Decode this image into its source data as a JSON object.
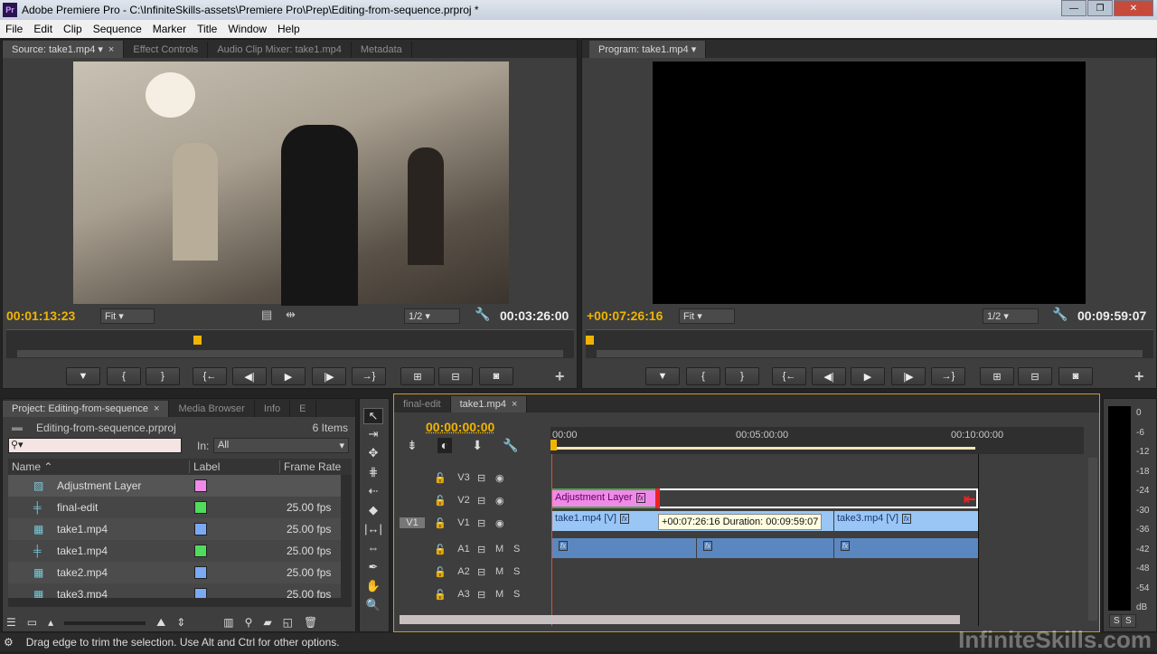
{
  "window": {
    "title": "Adobe Premiere Pro - C:\\InfiniteSkills-assets\\Premiere Pro\\Prep\\Editing-from-sequence.prproj *",
    "app_icon": "Pr"
  },
  "menu": [
    "File",
    "Edit",
    "Clip",
    "Sequence",
    "Marker",
    "Title",
    "Window",
    "Help"
  ],
  "source": {
    "tabs": [
      "Source: take1.mp4",
      "Effect Controls",
      "Audio Clip Mixer: take1.mp4",
      "Metadata"
    ],
    "timecode": "00:01:13:23",
    "zoom": "Fit",
    "resolution": "1/2",
    "duration": "00:03:26:00",
    "playhead_fraction": 0.33
  },
  "program": {
    "tab": "Program: take1.mp4",
    "timecode": "+00:07:26:16",
    "zoom": "Fit",
    "resolution": "1/2",
    "duration": "00:09:59:07",
    "playhead_fraction": 0.0
  },
  "transport": {
    "source": [
      "▼",
      "{",
      "}",
      "{←",
      "◀|",
      "▶",
      "|▶",
      "→}",
      "⊞",
      "⊟",
      "◙"
    ],
    "program": [
      "▼",
      "{",
      "}",
      "{←",
      "◀|",
      "▶",
      "|▶",
      "→}",
      "⊞",
      "⊟",
      "◙"
    ],
    "add": "+"
  },
  "project": {
    "tabs": [
      "Project: Editing-from-sequence",
      "Media Browser",
      "Info",
      "E"
    ],
    "file": "Editing-from-sequence.prproj",
    "count": "6 Items",
    "search_placeholder": "",
    "in_label": "In:",
    "in_value": "All",
    "columns": [
      "Name",
      "Label",
      "Frame Rate"
    ],
    "items": [
      {
        "name": "Adjustment Layer",
        "label_color": "#f08ae8",
        "fps": "",
        "icon": "adjustment-layer-icon"
      },
      {
        "name": "final-edit",
        "label_color": "#4fdc5c",
        "fps": "25.00 fps",
        "icon": "sequence-icon"
      },
      {
        "name": "take1.mp4",
        "label_color": "#7aaaf5",
        "fps": "25.00 fps",
        "icon": "clip-icon"
      },
      {
        "name": "take1.mp4",
        "label_color": "#4fdc5c",
        "fps": "25.00 fps",
        "icon": "sequence-icon"
      },
      {
        "name": "take2.mp4",
        "label_color": "#7aaaf5",
        "fps": "25.00 fps",
        "icon": "clip-icon"
      },
      {
        "name": "take3.mp4",
        "label_color": "#7aaaf5",
        "fps": "25.00 fps",
        "icon": "clip-icon"
      }
    ]
  },
  "tools": [
    "selection",
    "track-select",
    "ripple-edit",
    "rolling-edit",
    "rate-stretch",
    "razor",
    "slip",
    "slide",
    "pen",
    "hand",
    "zoom"
  ],
  "timeline": {
    "tabs": [
      "final-edit",
      "take1.mp4"
    ],
    "timecode": "00:00:00:00",
    "ruler": [
      "00:00",
      "00:05:00:00",
      "00:10:00:00"
    ],
    "video_tracks": [
      {
        "name": "V3"
      },
      {
        "name": "V2"
      },
      {
        "name": "V1",
        "source": "V1"
      }
    ],
    "audio_tracks": [
      {
        "name": "A1",
        "m": "M",
        "s": "S"
      },
      {
        "name": "A2",
        "m": "M",
        "s": "S"
      },
      {
        "name": "A3",
        "m": "M",
        "s": "S"
      }
    ],
    "clips": {
      "adjustment": "Adjustment Layer",
      "v1a": "take1.mp4 [V]",
      "v1b": "take3.mp4 [V]",
      "fx": "fx"
    },
    "tooltip": "+00:07:26:16 Duration: 00:09:59:07"
  },
  "meter": {
    "scale": [
      "0",
      "-6",
      "-12",
      "-18",
      "-24",
      "-30",
      "-36",
      "-42",
      "-48",
      "-54",
      "dB"
    ],
    "solo": [
      "S",
      "S"
    ]
  },
  "status": "Drag edge to trim the selection. Use Alt and Ctrl for other options.",
  "watermark": "InfiniteSkills.com",
  "colors": {
    "timecode": "#f0b400",
    "video_clip": "#9ac6f5",
    "audio_clip": "#5b87c0",
    "adjustment": "#f08ae8"
  }
}
